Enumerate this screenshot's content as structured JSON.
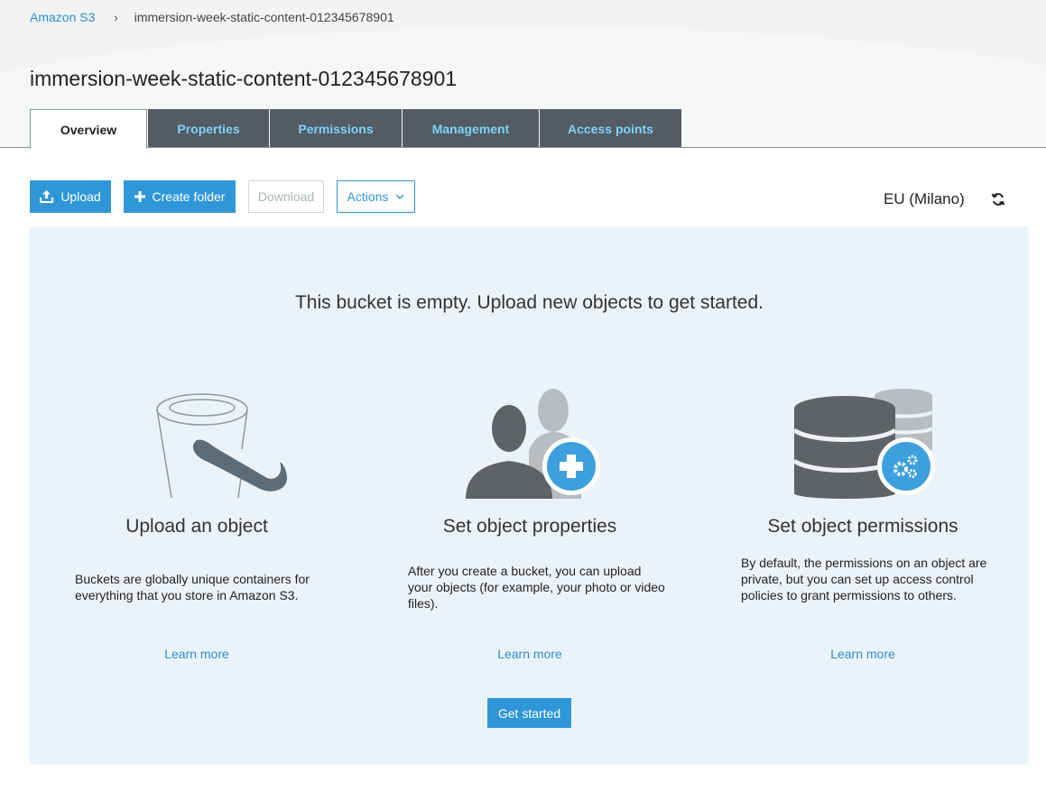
{
  "breadcrumb": {
    "root": "Amazon S3",
    "separator": "›",
    "current": "immersion-week-static-content-012345678901"
  },
  "page_title": "immersion-week-static-content-012345678901",
  "tabs": [
    {
      "label": "Overview",
      "active": true
    },
    {
      "label": "Properties",
      "active": false
    },
    {
      "label": "Permissions",
      "active": false
    },
    {
      "label": "Management",
      "active": false
    },
    {
      "label": "Access points",
      "active": false
    }
  ],
  "toolbar": {
    "upload_label": "Upload",
    "create_folder_label": "Create folder",
    "download_label": "Download",
    "actions_label": "Actions"
  },
  "region": "EU (Milano)",
  "empty_state": {
    "heading": "This bucket is empty. Upload new objects to get started.",
    "features": [
      {
        "title": "Upload an object",
        "text": "Buckets are globally unique containers for everything that you store in Amazon S3.",
        "link": "Learn more",
        "icon": "bucket-icon"
      },
      {
        "title": "Set object properties",
        "text": "After you create a bucket, you can upload your objects (for example, your photo or video files).",
        "link": "Learn more",
        "icon": "users-add-icon"
      },
      {
        "title": "Set object permissions",
        "text": "By default, the permissions on an object are private, but you can set up access control policies to grant permissions to others.",
        "link": "Learn more",
        "icon": "database-settings-icon"
      }
    ],
    "get_started_label": "Get started"
  },
  "colors": {
    "primary": "#2f97d8",
    "tab_bg": "#545b64",
    "tab_text": "#7bd3f5",
    "panel_bg": "#ebf3fa"
  }
}
